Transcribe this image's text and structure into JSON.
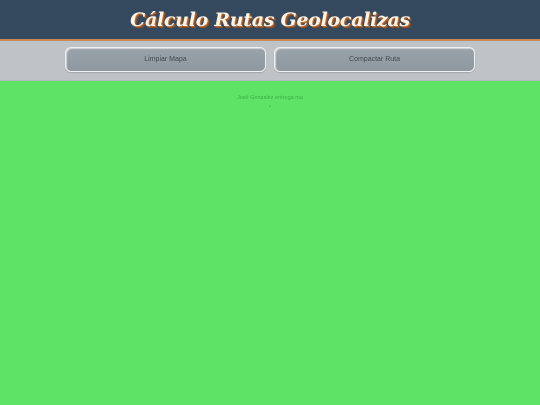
{
  "header": {
    "title": "Cálculo Rutas Geolocalizas"
  },
  "toolbar": {
    "clear_label": "Limpiar Mapa",
    "compact_label": "Compactar Ruta"
  },
  "map": {
    "credit": "José Gonzalez entrega ma",
    "credit_mark": "•"
  },
  "colors": {
    "header_bg": "#34495e",
    "toolbar_bg": "#bdc3c7",
    "button_bg": "#95a5a6",
    "map_bg": "#5ee366"
  }
}
